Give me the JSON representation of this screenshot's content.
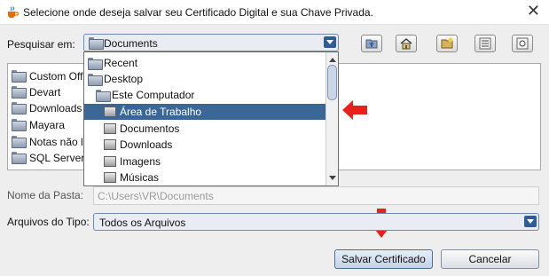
{
  "window": {
    "title": "Selecione onde deseja salvar seu Certificado Digital e sua Chave Privada.",
    "close_label": "✕"
  },
  "lookin": {
    "label": "Pesquisar em:",
    "value": "Documents"
  },
  "toolbar": {
    "icons": [
      "up-folder-icon",
      "home-icon",
      "new-folder-icon",
      "list-view-icon",
      "details-view-icon"
    ]
  },
  "file_list": {
    "items": [
      {
        "label": "Custom Offi",
        "icon": "folder-icon"
      },
      {
        "label": "Devart",
        "icon": "folder-icon"
      },
      {
        "label": "Downloads",
        "icon": "folder-icon"
      },
      {
        "label": "Mayara",
        "icon": "folder-icon"
      },
      {
        "label": "Notas não la",
        "icon": "folder-icon"
      },
      {
        "label": "SQL Server",
        "icon": "folder-icon"
      }
    ]
  },
  "dropdown": {
    "items": [
      {
        "label": "Recent",
        "icon": "folder-icon",
        "level": 0
      },
      {
        "label": "Desktop",
        "icon": "folder-icon",
        "level": 0
      },
      {
        "label": "Este Computador",
        "icon": "folder-icon",
        "level": 1
      },
      {
        "label": "Área de Trabalho",
        "icon": "drive-icon",
        "level": 2,
        "selected": true
      },
      {
        "label": "Documentos",
        "icon": "drive-icon",
        "level": 2
      },
      {
        "label": "Downloads",
        "icon": "drive-icon",
        "level": 2
      },
      {
        "label": "Imagens",
        "icon": "drive-icon",
        "level": 2
      },
      {
        "label": "Músicas",
        "icon": "drive-icon",
        "level": 2
      }
    ]
  },
  "folder_name": {
    "label": "Nome da Pasta:",
    "value": "C:\\Users\\VR\\Documents"
  },
  "file_type": {
    "label": "Arquivos do Tipo:",
    "value": "Todos os Arquivos"
  },
  "buttons": {
    "save": "Salvar Certificado",
    "cancel": "Cancelar"
  },
  "colors": {
    "selection": "#3b6797",
    "annotation_arrow": "#e8211b"
  }
}
